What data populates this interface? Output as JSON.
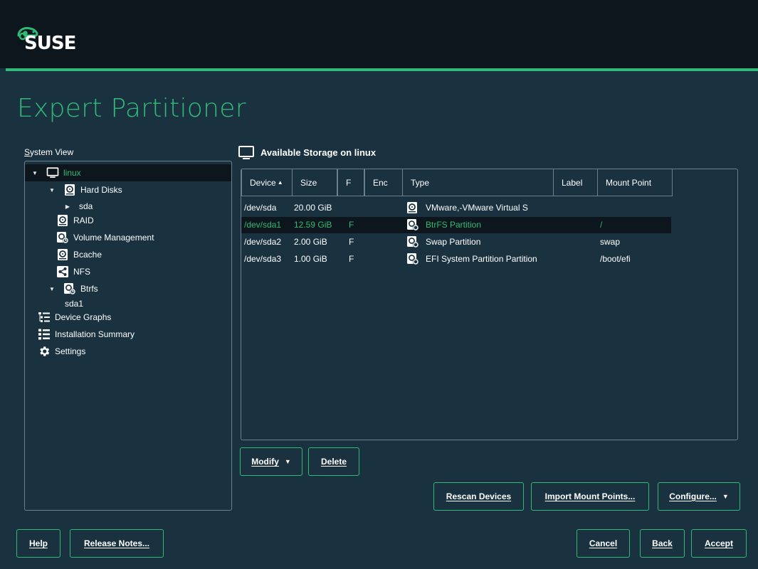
{
  "brand": {
    "logo_text": "SUSE"
  },
  "page": {
    "title": "Expert Partitioner"
  },
  "system_view": {
    "label": "System View",
    "tree": [
      {
        "label": "linux",
        "icon": "monitor-icon",
        "arrow": "down",
        "selected": true
      },
      {
        "label": "Hard Disks",
        "icon": "disk-icon",
        "arrow": "down"
      },
      {
        "label": "sda",
        "icon": "",
        "arrow": "right"
      },
      {
        "label": "RAID",
        "icon": "disk-icon",
        "arrow": ""
      },
      {
        "label": "Volume Management",
        "icon": "volume-icon",
        "arrow": ""
      },
      {
        "label": "Bcache",
        "icon": "disk-icon",
        "arrow": ""
      },
      {
        "label": "NFS",
        "icon": "share-icon",
        "arrow": ""
      },
      {
        "label": "Btrfs",
        "icon": "volume-icon",
        "arrow": "down"
      },
      {
        "label": "sda1",
        "icon": "",
        "arrow": ""
      },
      {
        "label": "Device Graphs",
        "icon": "graph-icon",
        "arrow": ""
      },
      {
        "label": "Installation Summary",
        "icon": "list-icon",
        "arrow": ""
      },
      {
        "label": "Settings",
        "icon": "gear-icon",
        "arrow": ""
      }
    ]
  },
  "storage": {
    "title": "Available Storage on linux",
    "columns": [
      "Device",
      "Size",
      "F",
      "Enc",
      "Type",
      "Label",
      "Mount Point"
    ],
    "sort_column": "Device",
    "rows": [
      {
        "device": "/dev/sda",
        "size": "20.00 GiB",
        "f": "",
        "enc": "",
        "type": "VMware,-VMware Virtual S",
        "type_icon": "disk-icon",
        "label": "",
        "mount": "",
        "selected": false
      },
      {
        "device": "/dev/sda1",
        "size": "12.59 GiB",
        "f": "F",
        "enc": "",
        "type": "BtrFS Partition",
        "type_icon": "partition-icon",
        "label": "",
        "mount": "/",
        "selected": true
      },
      {
        "device": "/dev/sda2",
        "size": "2.00 GiB",
        "f": "F",
        "enc": "",
        "type": "Swap Partition",
        "type_icon": "partition-icon",
        "label": "",
        "mount": "swap",
        "selected": false
      },
      {
        "device": "/dev/sda3",
        "size": "1.00 GiB",
        "f": "F",
        "enc": "",
        "type": "EFI System Partition Partition",
        "type_icon": "partition-icon",
        "label": "",
        "mount": "/boot/efi",
        "selected": false
      }
    ]
  },
  "actions": {
    "modify": "Modify",
    "delete": "Delete",
    "rescan": "Rescan Devices",
    "import": "Import Mount Points...",
    "configure": "Configure..."
  },
  "footer": {
    "help": "Help",
    "release_notes": "Release Notes...",
    "cancel": "Cancel",
    "back": "Back",
    "accept": "Accept"
  },
  "colors": {
    "accent": "#30ba78",
    "background": "#1a3240",
    "header": "#0c161c",
    "border": "#6a8090"
  }
}
